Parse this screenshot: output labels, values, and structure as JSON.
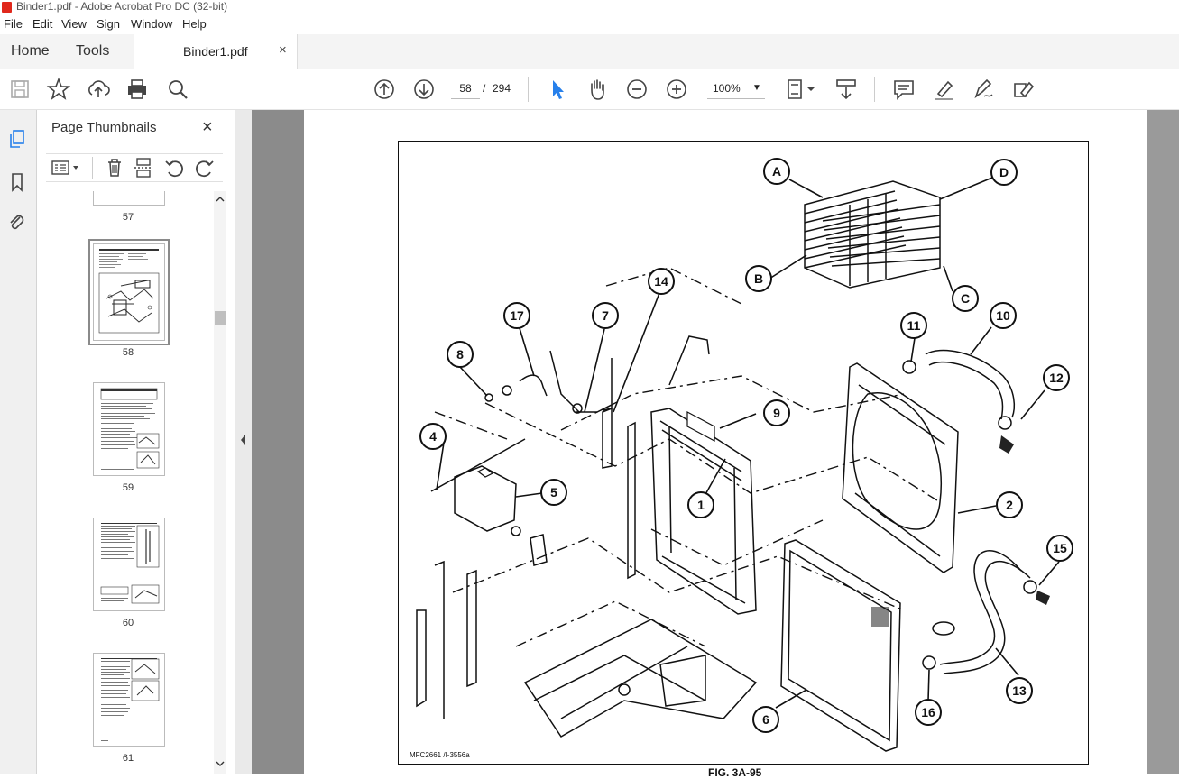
{
  "window": {
    "title": "Binder1.pdf - Adobe Acrobat Pro DC (32-bit)"
  },
  "menu": {
    "items": [
      "File",
      "Edit",
      "View",
      "Sign",
      "Window",
      "Help"
    ]
  },
  "tabs": {
    "home": "Home",
    "tools": "Tools",
    "document": "Binder1.pdf",
    "close": "×"
  },
  "toolbar": {
    "page_current": "58",
    "page_separator": "/",
    "page_total": "294",
    "zoom": "100%",
    "icons": [
      "save-icon",
      "star-icon",
      "upload-icon",
      "print-icon",
      "zoom-search-icon",
      "prev-page-icon",
      "next-page-icon",
      "select-cursor-icon",
      "hand-icon",
      "zoom-out-icon",
      "zoom-in-icon",
      "page-fit-icon",
      "scroll-mode-icon",
      "comment-icon",
      "highlight-icon",
      "sign-icon",
      "fill-sign-icon"
    ]
  },
  "thumbnails": {
    "title": "Page Thumbnails",
    "close": "×",
    "pages": [
      {
        "label": "57"
      },
      {
        "label": "58"
      },
      {
        "label": "59"
      },
      {
        "label": "60"
      },
      {
        "label": "61"
      }
    ],
    "selected": "58"
  },
  "figure": {
    "code": "MFC2661 /I-3556a",
    "caption": "FIG. 3A-95",
    "callouts": [
      "A",
      "B",
      "C",
      "D",
      "1",
      "2",
      "4",
      "5",
      "6",
      "7",
      "8",
      "9",
      "10",
      "11",
      "12",
      "13",
      "14",
      "15",
      "16",
      "17"
    ]
  },
  "colors": {
    "accent": "#2680eb",
    "title_icon": "#e0281c",
    "doc_bg": "#8b8b8b"
  }
}
